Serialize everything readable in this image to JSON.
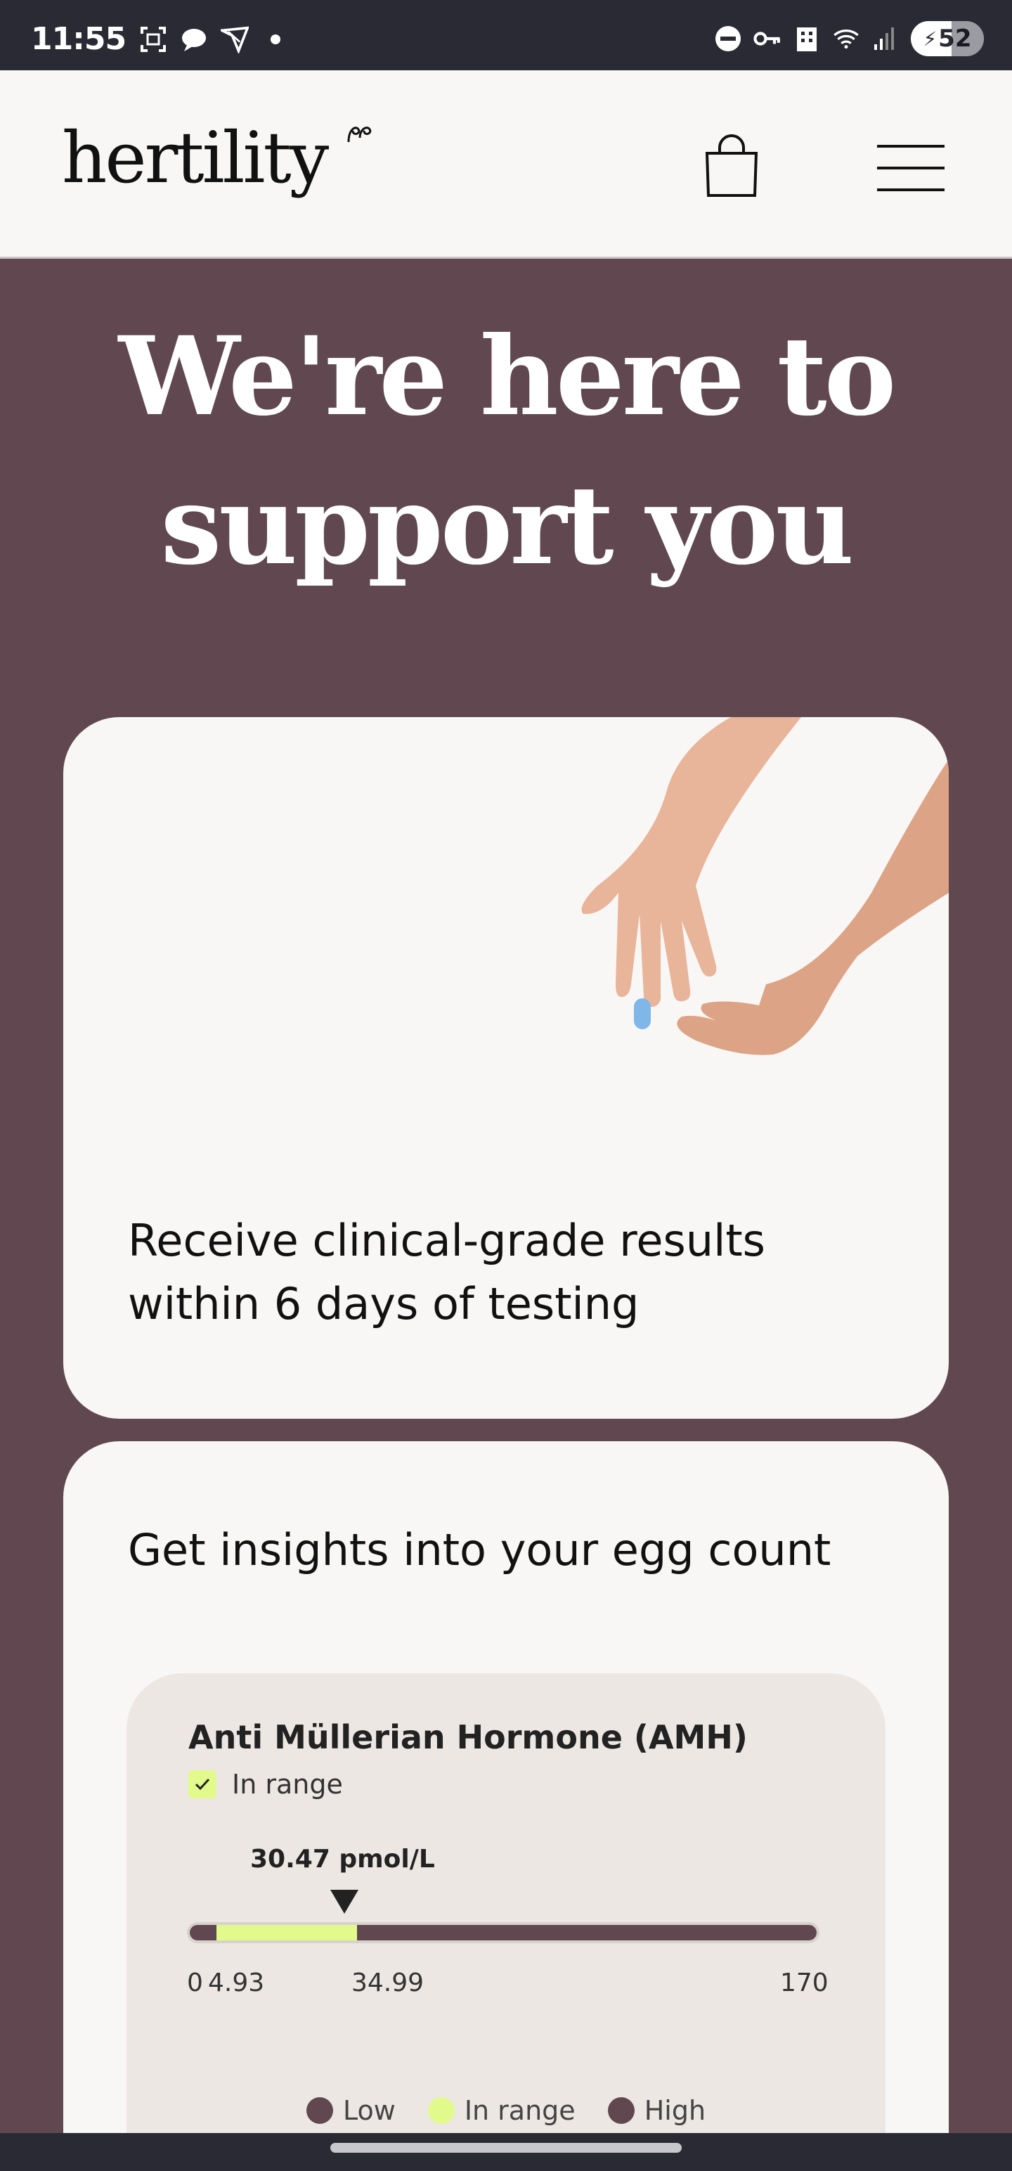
{
  "status_bar": {
    "time": "11:55",
    "battery": "52",
    "icons_left": [
      "screenshot-icon",
      "chat-icon",
      "ryanair-icon",
      "dot-icon"
    ],
    "icons_right": [
      "dnd-icon",
      "vpn-key-icon",
      "building-icon",
      "wifi-icon",
      "signal-icon",
      "battery-icon"
    ]
  },
  "header": {
    "logo": "hertility",
    "cart_icon": "shopping-bag-icon",
    "menu_icon": "hamburger-menu-icon"
  },
  "hero": {
    "title_line1": "We're here to",
    "title_line2": "support you"
  },
  "cards": [
    {
      "text_line1": "Receive clinical-grade results",
      "text_line2": "within 6 days of testing"
    },
    {
      "text": "Get insights into your egg count"
    }
  ],
  "amh": {
    "title": "Anti Müllerian Hormone (AMH)",
    "status": "In range",
    "value_label": "30.47 pmol/L",
    "value": 30.47,
    "range_low": 4.93,
    "range_high": 34.99,
    "scale_max": 170,
    "ticks": [
      "0",
      "4.93",
      "34.99",
      "170"
    ],
    "legend": [
      {
        "label": "Low",
        "color": "#614750"
      },
      {
        "label": "In range",
        "color": "#e2fa8c"
      },
      {
        "label": "High",
        "color": "#614750"
      }
    ]
  },
  "colors": {
    "background": "#614750",
    "card": "#f8f7f6",
    "accent": "#e2fa8c",
    "text": "#111111"
  }
}
